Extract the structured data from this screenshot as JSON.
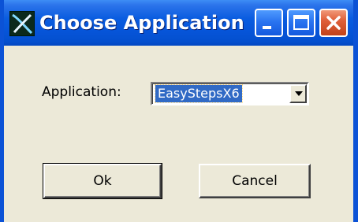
{
  "window": {
    "title": "Choose Application",
    "app_icon": "app-logo-icon",
    "title_buttons": [
      "minimize-icon",
      "maximize-icon",
      "close-icon"
    ],
    "colors": {
      "titlebar": "#0654d8",
      "client_bg": "#ece9d8",
      "close_button": "#e0603a",
      "selection": "#316ac5"
    }
  },
  "form": {
    "application_label": "Application:",
    "application_value": "EasyStepsX6",
    "dropdown_icon": "chevron-down-icon"
  },
  "buttons": {
    "ok_label": "Ok",
    "cancel_label": "Cancel"
  }
}
